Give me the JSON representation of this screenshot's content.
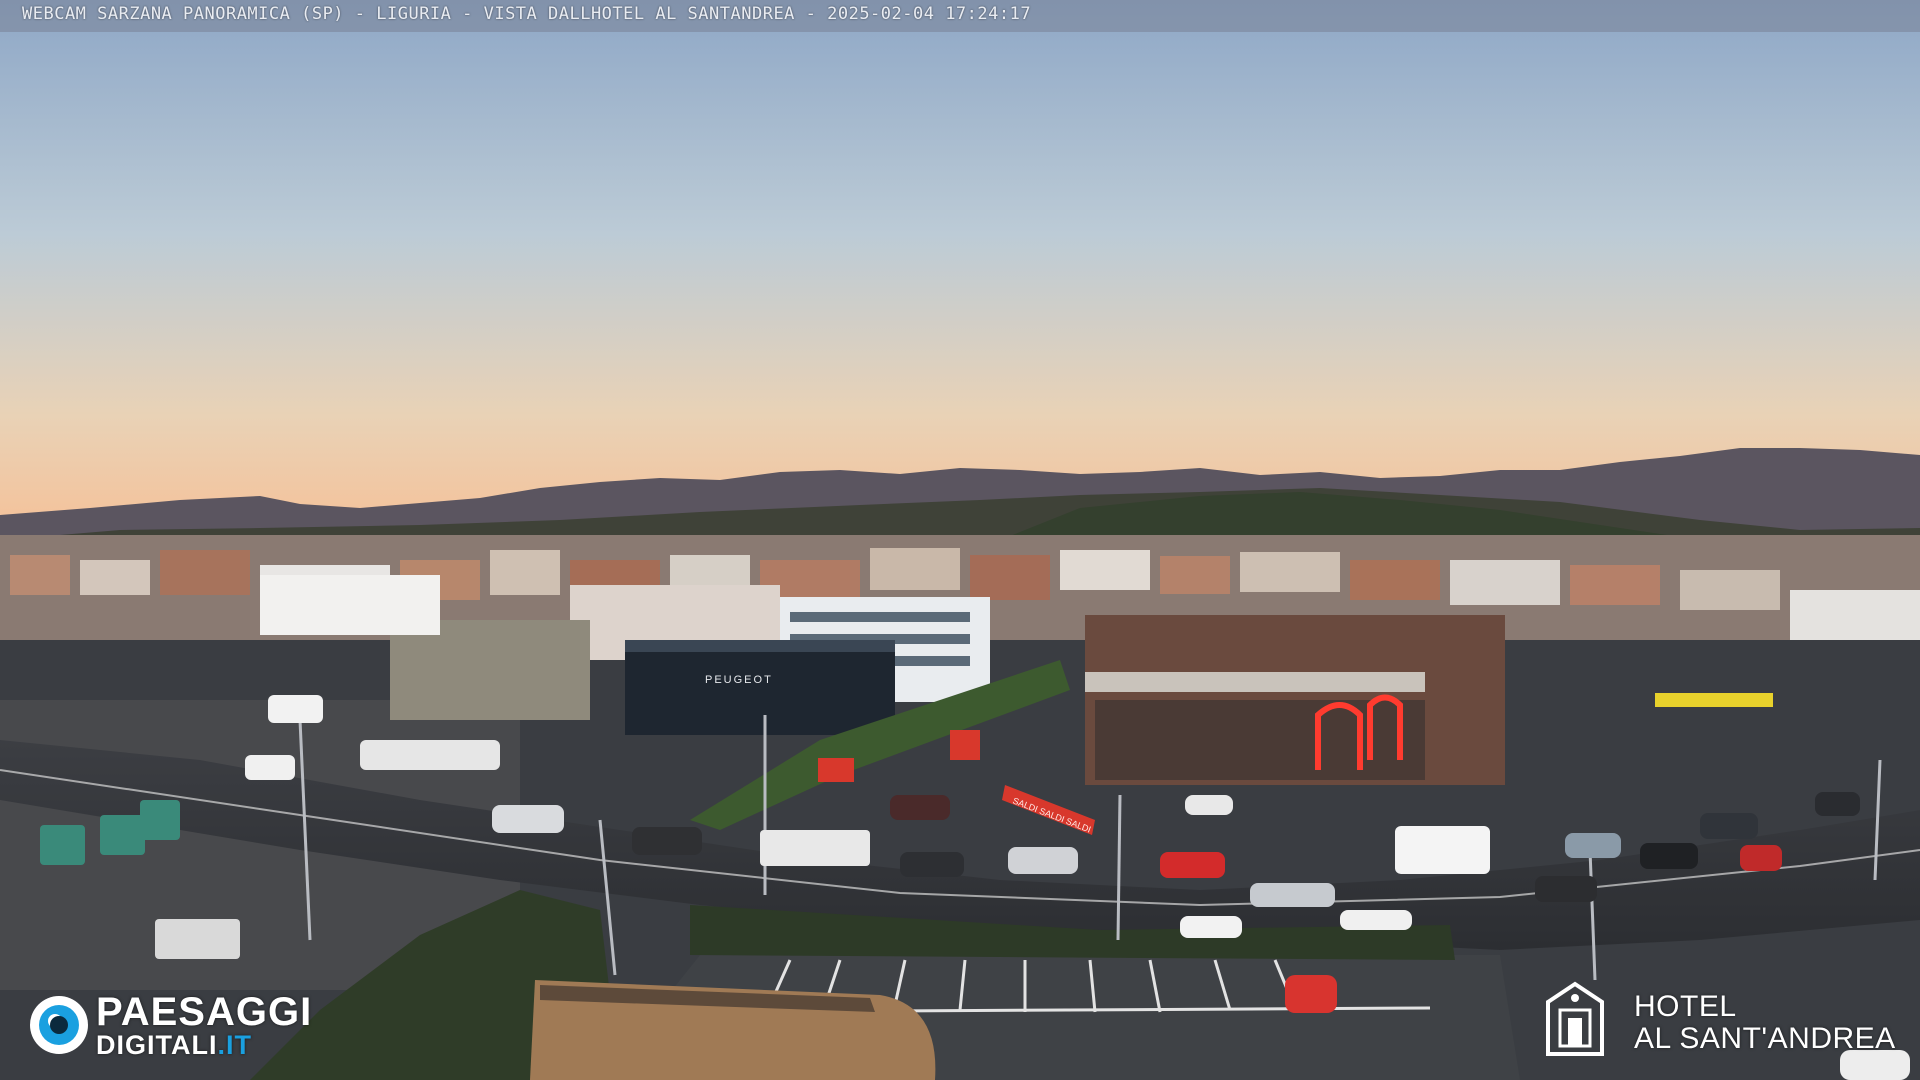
{
  "overlay": {
    "caption": "WEBCAM SARZANA PANORAMICA (SP) - LIGURIA - VISTA DALLHOTEL AL SANTANDREA - 2025-02-04  17:24:17"
  },
  "logos": {
    "paesaggi_line1": "PAESAGGI",
    "paesaggi_line2_a": "DIGITALI",
    "paesaggi_line2_b": ".IT",
    "hotel_line1": "HOTEL",
    "hotel_line2": "AL SANT'ANDREA"
  },
  "signs": {
    "dealer": "PEUGEOT",
    "banner": "SALDI SALDI SALDI"
  },
  "colors": {
    "sky_top": "#8fa8c6",
    "sky_horizon": "#f2c8a2",
    "mountains": "#4f4a57",
    "accent_red": "#d8382c",
    "logo_blue": "#1aa0e0"
  }
}
